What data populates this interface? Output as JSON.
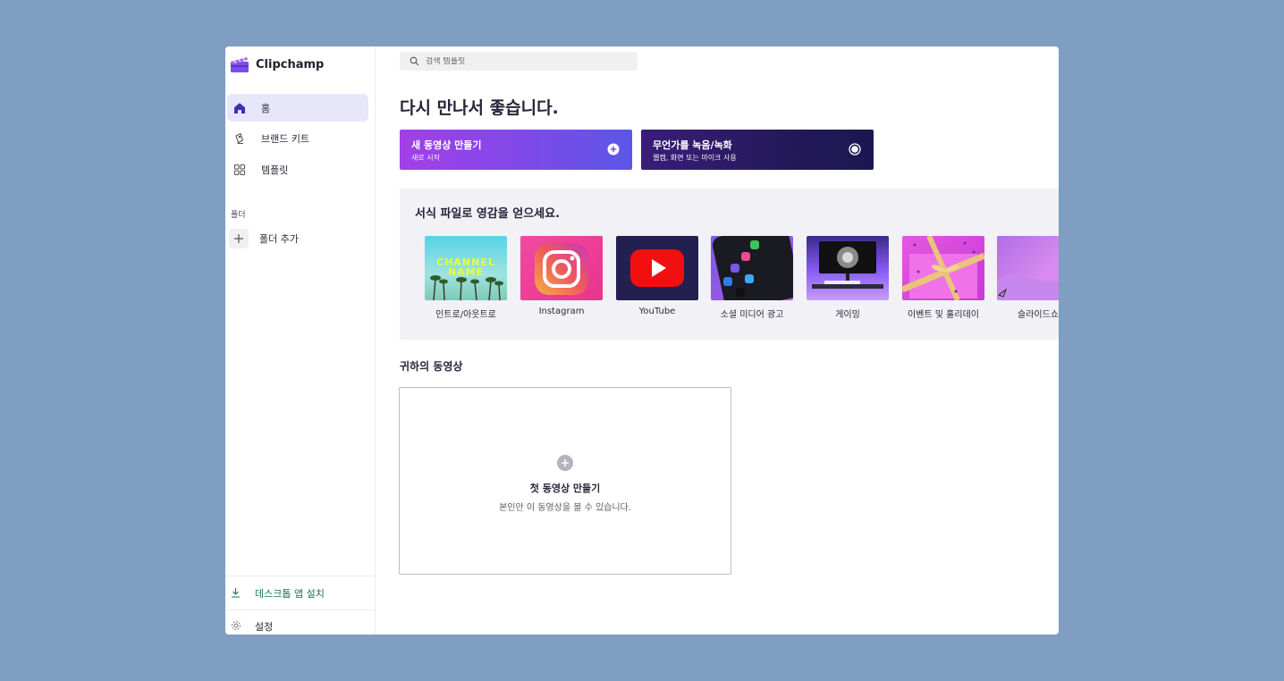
{
  "app": {
    "name": "Clipchamp"
  },
  "sidebar": {
    "items": [
      {
        "label": "홈",
        "icon": "home-icon"
      },
      {
        "label": "브랜드 키트",
        "icon": "brand-kit-icon"
      },
      {
        "label": "템플릿",
        "icon": "templates-icon"
      }
    ],
    "folders_label": "폴더",
    "add_folder": "폴더 추가",
    "install": "데스크톱 앱 설치",
    "settings": "설정"
  },
  "search": {
    "placeholder": "검색 템플릿"
  },
  "main": {
    "welcome": "다시 만나서 좋습니다.",
    "cta_new": {
      "title": "새 동영상 만들기",
      "subtitle": "새로 시작"
    },
    "cta_record": {
      "title": "무언가를 녹음/녹화",
      "subtitle": "웹캠, 화면 또는 마이크 사용"
    },
    "templates_heading": "서식 파일로 영감을 얻으세요.",
    "templates": [
      {
        "label": "인트로/아웃트로",
        "thumb_text": "CHANNEL NAME"
      },
      {
        "label": "Instagram"
      },
      {
        "label": "YouTube"
      },
      {
        "label": "소셜 미디어 광고"
      },
      {
        "label": "게이밍"
      },
      {
        "label": "이벤트 및 홀리데이"
      },
      {
        "label": "슬라이드쇼"
      }
    ],
    "your_videos_heading": "귀하의 동영상",
    "empty": {
      "title": "첫 동영상 만들기",
      "subtitle": "본인만 이 동영상을 볼 수 있습니다."
    }
  },
  "colors": {
    "accent": "#7e49e8",
    "active_nav_bg": "#e8e6fb",
    "backdrop": "#7f9ec1"
  }
}
